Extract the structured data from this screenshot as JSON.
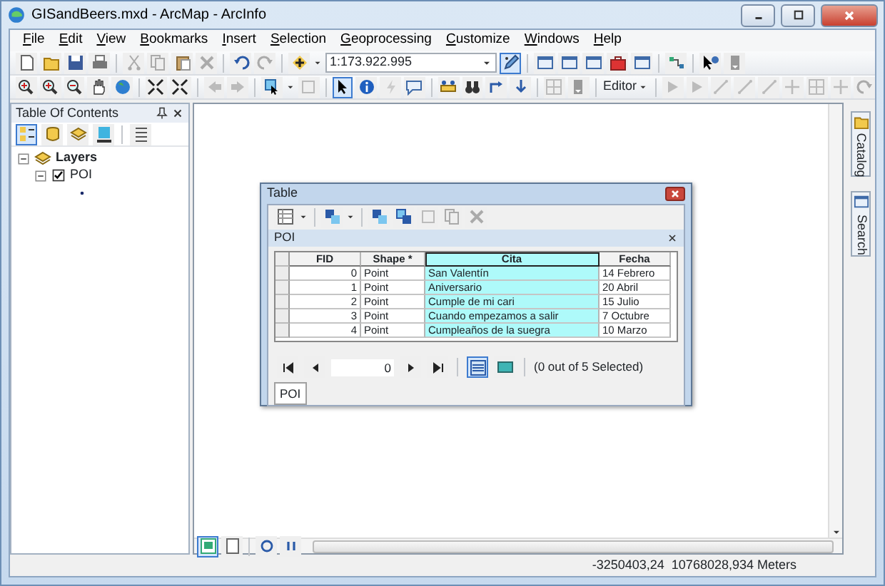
{
  "window": {
    "title": "GISandBeers.mxd - ArcMap - ArcInfo"
  },
  "menu": [
    {
      "label": "File"
    },
    {
      "label": "Edit"
    },
    {
      "label": "View"
    },
    {
      "label": "Bookmarks"
    },
    {
      "label": "Insert"
    },
    {
      "label": "Selection"
    },
    {
      "label": "Geoprocessing"
    },
    {
      "label": "Customize"
    },
    {
      "label": "Windows"
    },
    {
      "label": "Help"
    }
  ],
  "toolbar": {
    "scale": "1:173.922.995",
    "editor_menu": "Editor"
  },
  "toc": {
    "title": "Table Of Contents",
    "layers": {
      "label": "Layers",
      "expanded": true,
      "children": [
        {
          "label": "POI",
          "checked": true,
          "expanded": true
        }
      ]
    }
  },
  "dock_tabs": [
    {
      "label": "Catalog"
    },
    {
      "label": "Search"
    }
  ],
  "table_window": {
    "title": "Table",
    "table_name": "POI",
    "columns": [
      {
        "label": "FID",
        "selected": false
      },
      {
        "label": "Shape *",
        "selected": false
      },
      {
        "label": "Cita",
        "selected": true
      },
      {
        "label": "Fecha",
        "selected": false
      }
    ],
    "rows": [
      [
        "0",
        "Point",
        "San Valentín",
        "14 Febrero"
      ],
      [
        "1",
        "Point",
        "Aniversario",
        "20 Abril"
      ],
      [
        "2",
        "Point",
        "Cumple de mi cari",
        "15 Julio"
      ],
      [
        "3",
        "Point",
        "Cuando empezamos a salir",
        "7 Octubre"
      ],
      [
        "4",
        "Point",
        "Cumpleaños de la suegra",
        "10 Marzo"
      ]
    ],
    "record": "0",
    "selection_status": "(0 out of 5 Selected)",
    "tabs": [
      {
        "label": "POI",
        "selected": true
      }
    ]
  },
  "status_bar": {
    "coordinates": "-3250403,24  10768028,934 Meters"
  }
}
